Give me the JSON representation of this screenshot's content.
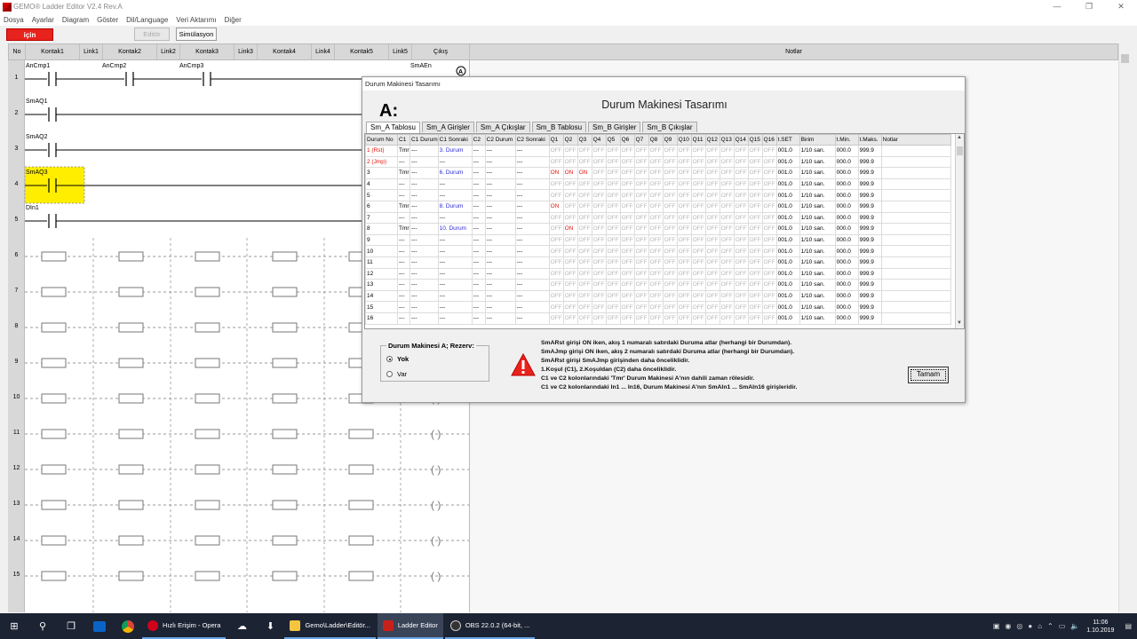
{
  "window": {
    "title": "GEMO® Ladder Editor V2.4 Rev.A",
    "controls": [
      "—",
      "❐",
      "✕"
    ]
  },
  "menu": [
    "Dosya",
    "Ayarlar",
    "Diagram",
    "Göster",
    "Dil/Language",
    "Veri Aktarımı",
    "Diğer"
  ],
  "toolbar": {
    "icin": "için",
    "editor": "Editör",
    "simulation": "Simülasyon"
  },
  "ladder_header": [
    "No",
    "Kontak1",
    "Link1",
    "Kontak2",
    "Link2",
    "Kontak3",
    "Link3",
    "Kontak4",
    "Link4",
    "Kontak5",
    "Link5",
    "Çıkış",
    "Notlar"
  ],
  "rows": [
    "1",
    "2",
    "3",
    "4",
    "5",
    "6",
    "7",
    "8",
    "9",
    "10",
    "11",
    "12",
    "13",
    "14",
    "15"
  ],
  "contacts": {
    "r1": [
      "AnCmp1",
      "AnCmp2",
      "AnCmp3"
    ],
    "r1_out": "SmAEn",
    "r2": "SmAQ1",
    "r3": "SmAQ2",
    "r4": "SmAQ3",
    "r5": "DIn1"
  },
  "dialog": {
    "title": "Durum Makinesi Tasarımı",
    "heading": "Durum Makinesi Tasarımı",
    "big_label": "A:",
    "tabs": [
      "Sm_A Tablosu",
      "Sm_A Girişler",
      "Sm_A Çıkışlar",
      "Sm_B Tablosu",
      "Sm_B Girişler",
      "Sm_B Çıkışlar"
    ],
    "columns": [
      "Durum No",
      "C1",
      "C1 Durum",
      "C1 Sonraki",
      "C2",
      "C2 Durum",
      "C2 Sonraki",
      "Q1",
      "Q2",
      "Q3",
      "Q4",
      "Q5",
      "Q6",
      "Q7",
      "Q8",
      "Q9",
      "Q10",
      "Q11",
      "Q12",
      "Q13",
      "Q14",
      "Q15",
      "Q16",
      "t.SET",
      "Birim",
      "t.Min.",
      "t.Maks.",
      "Notlar"
    ],
    "table": [
      {
        "no": "1 (Rst)",
        "c1": "Tmr",
        "c1d": "---",
        "c1s": "3. Durum",
        "q": [
          "OFF",
          "OFF",
          "OFF",
          "OFF",
          "OFF",
          "OFF",
          "OFF",
          "OFF",
          "OFF",
          "OFF",
          "OFF",
          "OFF",
          "OFF",
          "OFF",
          "OFF",
          "OFF"
        ]
      },
      {
        "no": "2 (Jmp)",
        "c1": "---",
        "c1d": "---",
        "c1s": "---",
        "q": [
          "OFF",
          "OFF",
          "OFF",
          "OFF",
          "OFF",
          "OFF",
          "OFF",
          "OFF",
          "OFF",
          "OFF",
          "OFF",
          "OFF",
          "OFF",
          "OFF",
          "OFF",
          "OFF"
        ]
      },
      {
        "no": "3",
        "c1": "Tmr",
        "c1d": "---",
        "c1s": "6. Durum",
        "q": [
          "ON",
          "ON",
          "ON",
          "OFF",
          "OFF",
          "OFF",
          "OFF",
          "OFF",
          "OFF",
          "OFF",
          "OFF",
          "OFF",
          "OFF",
          "OFF",
          "OFF",
          "OFF"
        ]
      },
      {
        "no": "4",
        "c1": "---",
        "c1d": "---",
        "c1s": "---",
        "q": [
          "OFF",
          "OFF",
          "OFF",
          "OFF",
          "OFF",
          "OFF",
          "OFF",
          "OFF",
          "OFF",
          "OFF",
          "OFF",
          "OFF",
          "OFF",
          "OFF",
          "OFF",
          "OFF"
        ]
      },
      {
        "no": "5",
        "c1": "---",
        "c1d": "---",
        "c1s": "---",
        "q": [
          "OFF",
          "OFF",
          "OFF",
          "OFF",
          "OFF",
          "OFF",
          "OFF",
          "OFF",
          "OFF",
          "OFF",
          "OFF",
          "OFF",
          "OFF",
          "OFF",
          "OFF",
          "OFF"
        ]
      },
      {
        "no": "6",
        "c1": "Tmr",
        "c1d": "---",
        "c1s": "8. Durum",
        "q": [
          "ON",
          "OFF",
          "OFF",
          "OFF",
          "OFF",
          "OFF",
          "OFF",
          "OFF",
          "OFF",
          "OFF",
          "OFF",
          "OFF",
          "OFF",
          "OFF",
          "OFF",
          "OFF"
        ]
      },
      {
        "no": "7",
        "c1": "---",
        "c1d": "---",
        "c1s": "---",
        "q": [
          "OFF",
          "OFF",
          "OFF",
          "OFF",
          "OFF",
          "OFF",
          "OFF",
          "OFF",
          "OFF",
          "OFF",
          "OFF",
          "OFF",
          "OFF",
          "OFF",
          "OFF",
          "OFF"
        ]
      },
      {
        "no": "8",
        "c1": "Tmr",
        "c1d": "---",
        "c1s": "10. Durum",
        "q": [
          "OFF",
          "ON",
          "OFF",
          "OFF",
          "OFF",
          "OFF",
          "OFF",
          "OFF",
          "OFF",
          "OFF",
          "OFF",
          "OFF",
          "OFF",
          "OFF",
          "OFF",
          "OFF"
        ]
      },
      {
        "no": "9",
        "c1": "---",
        "c1d": "---",
        "c1s": "---",
        "q": [
          "OFF",
          "OFF",
          "OFF",
          "OFF",
          "OFF",
          "OFF",
          "OFF",
          "OFF",
          "OFF",
          "OFF",
          "OFF",
          "OFF",
          "OFF",
          "OFF",
          "OFF",
          "OFF"
        ]
      },
      {
        "no": "10",
        "c1": "---",
        "c1d": "---",
        "c1s": "---",
        "q": [
          "OFF",
          "OFF",
          "OFF",
          "OFF",
          "OFF",
          "OFF",
          "OFF",
          "OFF",
          "OFF",
          "OFF",
          "OFF",
          "OFF",
          "OFF",
          "OFF",
          "OFF",
          "OFF"
        ]
      },
      {
        "no": "11",
        "c1": "---",
        "c1d": "---",
        "c1s": "---",
        "q": [
          "OFF",
          "OFF",
          "OFF",
          "OFF",
          "OFF",
          "OFF",
          "OFF",
          "OFF",
          "OFF",
          "OFF",
          "OFF",
          "OFF",
          "OFF",
          "OFF",
          "OFF",
          "OFF"
        ]
      },
      {
        "no": "12",
        "c1": "---",
        "c1d": "---",
        "c1s": "---",
        "q": [
          "OFF",
          "OFF",
          "OFF",
          "OFF",
          "OFF",
          "OFF",
          "OFF",
          "OFF",
          "OFF",
          "OFF",
          "OFF",
          "OFF",
          "OFF",
          "OFF",
          "OFF",
          "OFF"
        ]
      },
      {
        "no": "13",
        "c1": "---",
        "c1d": "---",
        "c1s": "---",
        "q": [
          "OFF",
          "OFF",
          "OFF",
          "OFF",
          "OFF",
          "OFF",
          "OFF",
          "OFF",
          "OFF",
          "OFF",
          "OFF",
          "OFF",
          "OFF",
          "OFF",
          "OFF",
          "OFF"
        ]
      },
      {
        "no": "14",
        "c1": "---",
        "c1d": "---",
        "c1s": "---",
        "q": [
          "OFF",
          "OFF",
          "OFF",
          "OFF",
          "OFF",
          "OFF",
          "OFF",
          "OFF",
          "OFF",
          "OFF",
          "OFF",
          "OFF",
          "OFF",
          "OFF",
          "OFF",
          "OFF"
        ]
      },
      {
        "no": "15",
        "c1": "---",
        "c1d": "---",
        "c1s": "---",
        "q": [
          "OFF",
          "OFF",
          "OFF",
          "OFF",
          "OFF",
          "OFF",
          "OFF",
          "OFF",
          "OFF",
          "OFF",
          "OFF",
          "OFF",
          "OFF",
          "OFF",
          "OFF",
          "OFF"
        ]
      },
      {
        "no": "16",
        "c1": "---",
        "c1d": "---",
        "c1s": "---",
        "q": [
          "OFF",
          "OFF",
          "OFF",
          "OFF",
          "OFF",
          "OFF",
          "OFF",
          "OFF",
          "OFF",
          "OFF",
          "OFF",
          "OFF",
          "OFF",
          "OFF",
          "OFF",
          "OFF"
        ]
      }
    ],
    "tset": "001.0",
    "birim": "1/10 san.",
    "tmin": "000.0",
    "tmaks": "999.9",
    "reserve_legend": "Durum Makinesi A; Rezerv:",
    "reserve_options": [
      "Yok",
      "Var"
    ],
    "info_lines": [
      "SmARst girişi ON iken, akış 1 numaralı satırdaki Duruma atlar (herhangi bir Durumdan).",
      "SmAJmp girişi ON iken, akış 2 numaralı satırdaki Duruma atlar (herhangi bir Durumdan).",
      "SmARst girişi SmAJmp girişinden daha önceliklidir.",
      "1.Koşul (C1), 2.Koşuldan (C2) daha önceliklidir.",
      "C1 ve C2 kolonlarındaki 'Tmr' Durum Makinesi A'nın dahili zaman rölesidir.",
      "C1 ve C2 kolonlarındaki In1 ... In16, Durum Makinesi A'nın SmAIn1 ... SmAIn16 girişleridir."
    ],
    "ok_button": "Tamam"
  },
  "taskbar": {
    "apps": [
      "Hızlı Erişim - Opera",
      "Gemo\\Ladder\\Editör...",
      "Ladder Editor",
      "OBS 22.0.2 (64-bit, ..."
    ],
    "time": "11:06",
    "date": "1.10.2019"
  },
  "colors": {
    "accent_red": "#e8221d",
    "highlight_yellow": "#ffee00",
    "on_red": "#e0150c",
    "link_blue": "#2b2bd6"
  }
}
